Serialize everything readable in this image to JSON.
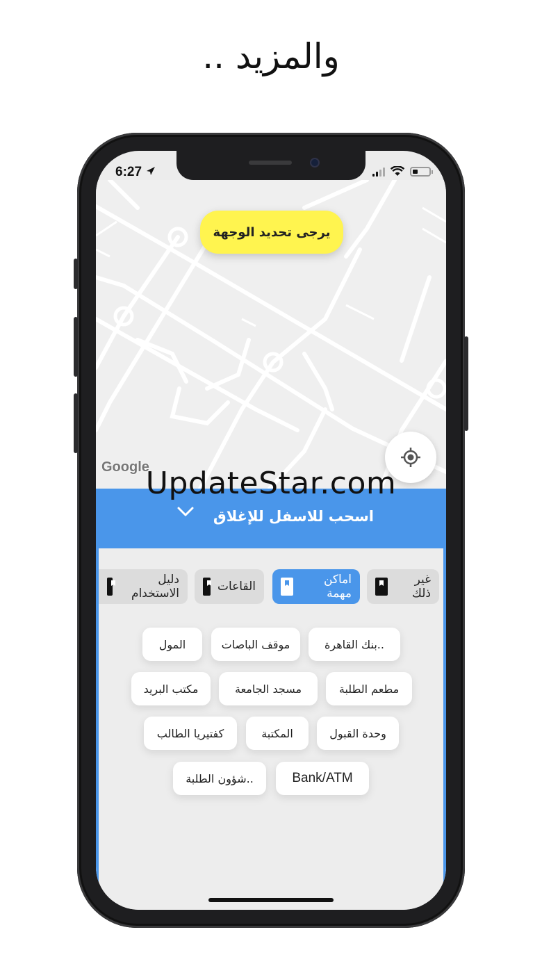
{
  "headline": "والمزيد ..",
  "status_bar": {
    "time": "6:27"
  },
  "map": {
    "destination_prompt": "يرجى تحديد الوجهة",
    "attribution": "Google"
  },
  "watermark": "UpdateStar.com",
  "sheet": {
    "handle_label": "اسحب للاسفل للإغلاق"
  },
  "tabs": [
    {
      "label": "غير ذلك",
      "active": false
    },
    {
      "label": "اماكن مهمة",
      "active": true
    },
    {
      "label": "القاعات",
      "active": false
    },
    {
      "label": "دليل الاستخدام",
      "active": false
    }
  ],
  "places": [
    "..بنك القاهرة",
    "موقف الباصات",
    "المول",
    "مطعم الطلبة",
    "مسجد الجامعة",
    "مكتب البريد",
    "وحدة القبول",
    "المكتبة",
    "كفتيريا الطالب",
    "Bank/ATM",
    "..شؤون الطلبة"
  ],
  "colors": {
    "accent": "#4a96ea",
    "destination_pill": "#fff44f",
    "sheet_background": "#ededed"
  }
}
